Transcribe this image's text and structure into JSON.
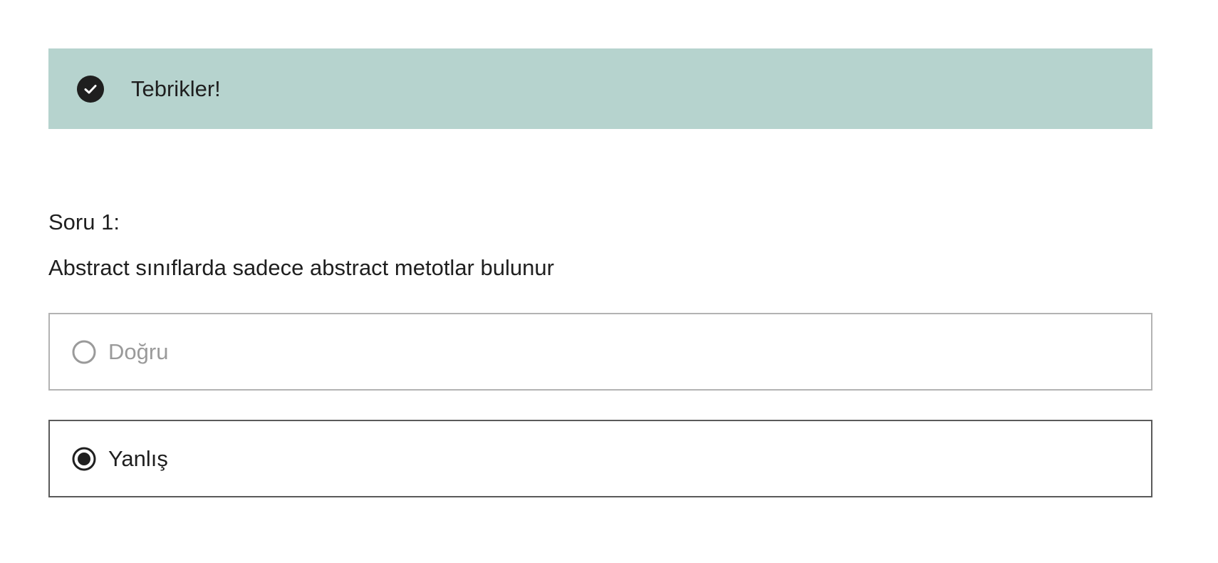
{
  "banner": {
    "message": "Tebrikler!",
    "icon": "check-circle-icon",
    "background_color": "#b6d3ce"
  },
  "question": {
    "label": "Soru 1:",
    "text": "Abstract sınıflarda sadece abstract metotlar bulunur"
  },
  "options": [
    {
      "label": "Doğru",
      "selected": false
    },
    {
      "label": "Yanlış",
      "selected": true
    }
  ]
}
